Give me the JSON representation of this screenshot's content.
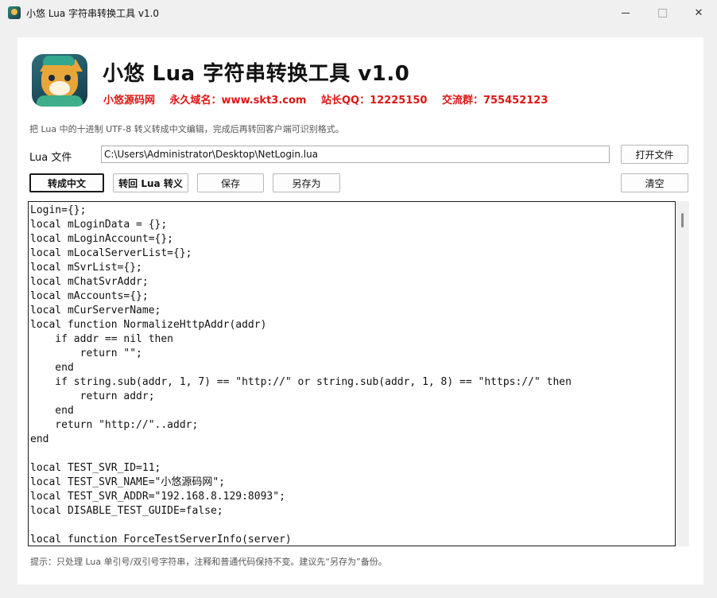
{
  "window": {
    "title": "小悠 Lua 字符串转换工具 v1.0",
    "min_glyph": "—",
    "max_glyph": "☐",
    "close_glyph": "✕"
  },
  "header": {
    "title": "小悠 Lua 字符串转换工具 v1.0",
    "site": "小悠源码网",
    "domain": "永久域名：www.skt3.com",
    "qq": "站长QQ：12225150",
    "group": "交流群：755452123",
    "accent_color": "#e01515"
  },
  "description": "把 Lua 中的十进制 UTF-8 转义转成中文编辑，完成后再转回客户端可识别格式。",
  "file": {
    "label": "Lua 文件",
    "path": "C:\\Users\\Administrator\\Desktop\\NetLogin.lua"
  },
  "buttons": {
    "open": "打开文件",
    "to_chinese": "转成中文",
    "to_lua": "转回 Lua 转义",
    "save": "保存",
    "save_as": "另存为",
    "clear": "清空"
  },
  "editor": {
    "lines": [
      "Login={};",
      "local mLoginData = {};",
      "local mLoginAccount={};",
      "local mLocalServerList={};",
      "local mSvrList={};",
      "local mChatSvrAddr;",
      "local mAccounts={};",
      "local mCurServerName;",
      "local function NormalizeHttpAddr(addr)",
      "    if addr == nil then",
      "        return \"\";",
      "    end",
      "    if string.sub(addr, 1, 7) == \"http://\" or string.sub(addr, 1, 8) == \"https://\" then",
      "        return addr;",
      "    end",
      "    return \"http://\"..addr;",
      "end",
      "",
      "local TEST_SVR_ID=11;",
      "local TEST_SVR_NAME=\"小悠源码网\";",
      "local TEST_SVR_ADDR=\"192.168.8.129:8093\";",
      "local DISABLE_TEST_GUIDE=false;",
      "",
      "local function ForceTestServerInfo(server)"
    ]
  },
  "tip": "提示：只处理 Lua 单引号/双引号字符串，注释和普通代码保持不变。建议先“另存为”备份。"
}
